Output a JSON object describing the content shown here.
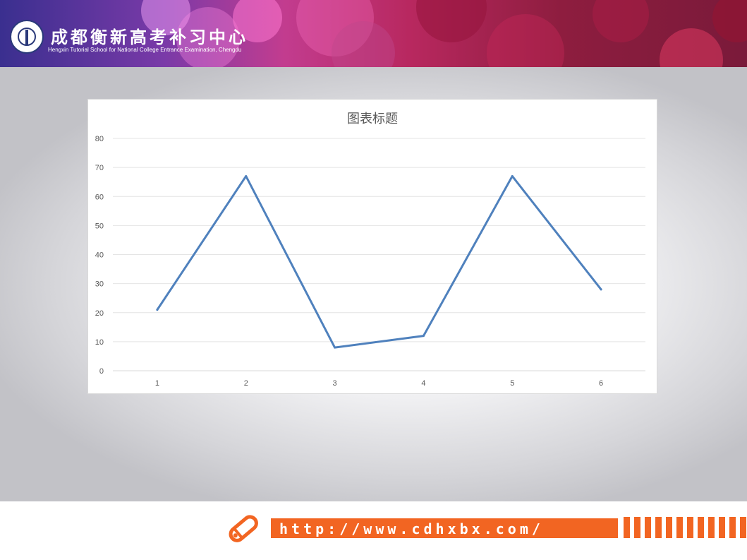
{
  "header": {
    "brand_cn": "成都衡新高考补习中心",
    "brand_en": "Hengxin Tutorial School for National College Entrance Examination, Chengdu",
    "logo_icon": "school-emblem-icon"
  },
  "footer": {
    "url": "http://www.cdhxbx.com/",
    "accent_color": "#f26522",
    "icon": "pencil-icon"
  },
  "chart_data": {
    "type": "line",
    "title": "图表标题",
    "xlabel": "",
    "ylabel": "",
    "categories": [
      "1",
      "2",
      "3",
      "4",
      "5",
      "6"
    ],
    "series": [
      {
        "values": [
          21,
          67,
          8,
          12,
          67,
          28
        ],
        "color": "#4f81bd"
      }
    ],
    "ylim": [
      0,
      80
    ],
    "yticks": [
      0,
      10,
      20,
      30,
      40,
      50,
      60,
      70,
      80
    ],
    "grid": true,
    "legend": "none"
  }
}
